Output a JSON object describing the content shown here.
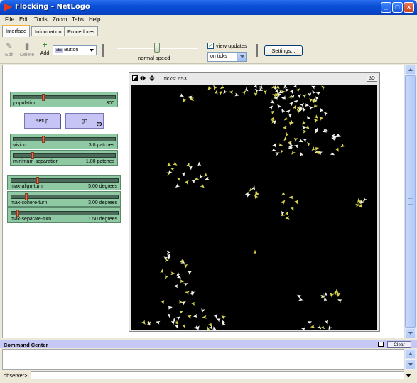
{
  "window": {
    "title": "Flocking - NetLogo"
  },
  "menu": [
    "File",
    "Edit",
    "Tools",
    "Zoom",
    "Tabs",
    "Help"
  ],
  "tabs": [
    "Interface",
    "Information",
    "Procedures"
  ],
  "toolbar": {
    "edit": "Edit",
    "delete": "Delete",
    "add": "Add",
    "widget_type": "Button",
    "speed_label": "normal speed",
    "speed_level": 0.5,
    "view_updates": "view updates",
    "update_mode": "on ticks",
    "settings": "Settings..."
  },
  "widgets": {
    "population": {
      "label": "population",
      "value": "300",
      "fraction": 0.3
    },
    "setup": "setup",
    "go": "go",
    "vision": {
      "label": "vision",
      "value": "3.0 patches",
      "fraction": 0.3
    },
    "minimum_separation": {
      "label": "minimum-separation",
      "value": "1.00 patches",
      "fraction": 0.2
    },
    "max_align_turn": {
      "label": "max-align-turn",
      "value": "5.00 degrees",
      "fraction": 0.25
    },
    "max_cohere_turn": {
      "label": "max-cohere-turn",
      "value": "3.00 degrees",
      "fraction": 0.15
    },
    "max_separate_turn": {
      "label": "max-separate-turn",
      "value": "1.50 degrees",
      "fraction": 0.075
    }
  },
  "view": {
    "ticks": "ticks: 653",
    "three_d": "3D"
  },
  "command_center": {
    "title": "Command Center",
    "clear": "Clear",
    "prompt": "observer>"
  },
  "colors": {
    "agent_bright": "#f2f2ea",
    "agent_yellow": "#d8d34c",
    "world_bg": "#000000"
  }
}
